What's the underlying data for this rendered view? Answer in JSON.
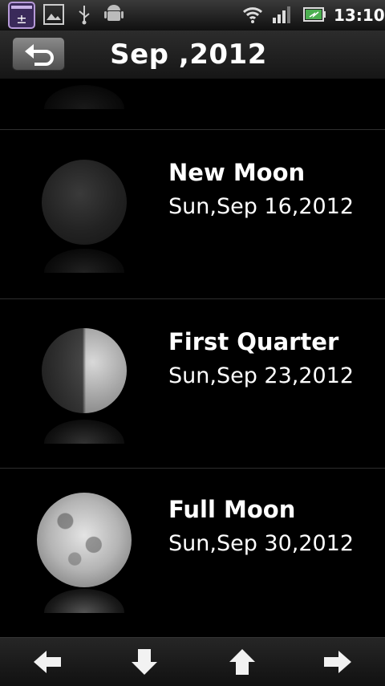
{
  "status_bar": {
    "time": "13:10",
    "icons": [
      "calculator-app-icon",
      "photo-app-icon",
      "usb-icon",
      "android-debug-icon",
      "wifi-icon",
      "signal-icon",
      "battery-icon"
    ]
  },
  "header": {
    "title": "Sep ,2012",
    "back_icon": "back-arrow-icon"
  },
  "phases": [
    {
      "name": "New Moon",
      "date": "Sun,Sep 16,2012",
      "icon": "new-moon-icon"
    },
    {
      "name": "First Quarter",
      "date": "Sun,Sep 23,2012",
      "icon": "first-quarter-moon-icon"
    },
    {
      "name": "Full Moon",
      "date": "Sun,Sep 30,2012",
      "icon": "full-moon-icon"
    }
  ],
  "bottom_nav": {
    "icons": [
      "arrow-left-icon",
      "arrow-down-icon",
      "arrow-up-icon",
      "arrow-right-icon"
    ]
  },
  "colors": {
    "background": "#000000",
    "text": "#ffffff",
    "bar": "#1c1c1c"
  }
}
